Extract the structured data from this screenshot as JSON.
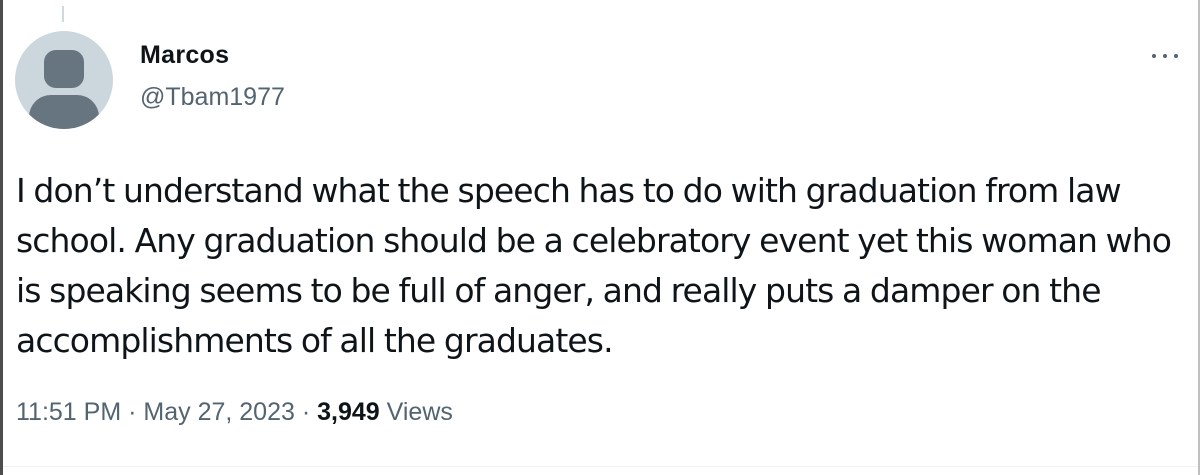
{
  "author": {
    "display_name": "Marcos",
    "handle": "@Tbam1977"
  },
  "tweet": {
    "text": "I don’t understand what the speech has to do with graduation from law school. Any graduation should be a celebratory event yet this woman who is speaking seems to be full of anger, and really puts a damper on the accomplishments of all the graduates."
  },
  "meta": {
    "time": "11:51 PM",
    "separator": "·",
    "date": "May 27, 2023",
    "views_count": "3,949",
    "views_label": "Views"
  },
  "icons": {
    "more": "more-options-icon",
    "avatar": "default-avatar-icon"
  },
  "colors": {
    "text_primary": "#0f1419",
    "text_secondary": "#536471",
    "avatar_bg": "#ccd6dd",
    "avatar_fg": "#66757f"
  }
}
